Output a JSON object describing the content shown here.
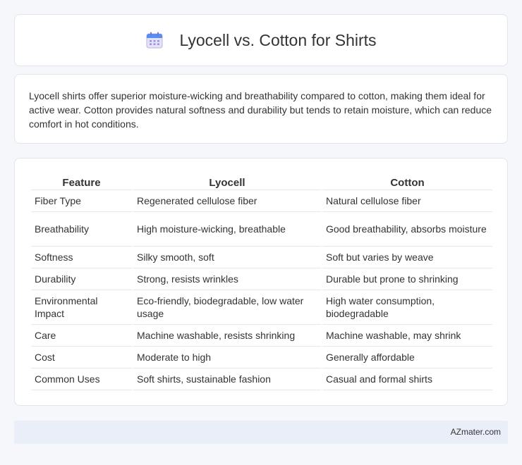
{
  "header": {
    "title": "Lyocell vs. Cotton for Shirts",
    "icon": "calendar-icon"
  },
  "intro": {
    "text": "Lyocell shirts offer superior moisture-wicking and breathability compared to cotton, making them ideal for active wear. Cotton provides natural softness and durability but tends to retain moisture, which can reduce comfort in hot conditions."
  },
  "table": {
    "headers": [
      "Feature",
      "Lyocell",
      "Cotton"
    ],
    "rows": [
      [
        "Fiber Type",
        "Regenerated cellulose fiber",
        "Natural cellulose fiber"
      ],
      [
        "Breathability",
        "High moisture-wicking, breathable",
        "Good breathability, absorbs moisture"
      ],
      [
        "Softness",
        "Silky smooth, soft",
        "Soft but varies by weave"
      ],
      [
        "Durability",
        "Strong, resists wrinkles",
        "Durable but prone to shrinking"
      ],
      [
        "Environmental Impact",
        "Eco-friendly, biodegradable, low water usage",
        "High water consumption, biodegradable"
      ],
      [
        "Care",
        "Machine washable, resists shrinking",
        "Machine washable, may shrink"
      ],
      [
        "Cost",
        "Moderate to high",
        "Generally affordable"
      ],
      [
        "Common Uses",
        "Soft shirts, sustainable fashion",
        "Casual and formal shirts"
      ]
    ]
  },
  "footer": {
    "brand": "AZmater.com"
  }
}
